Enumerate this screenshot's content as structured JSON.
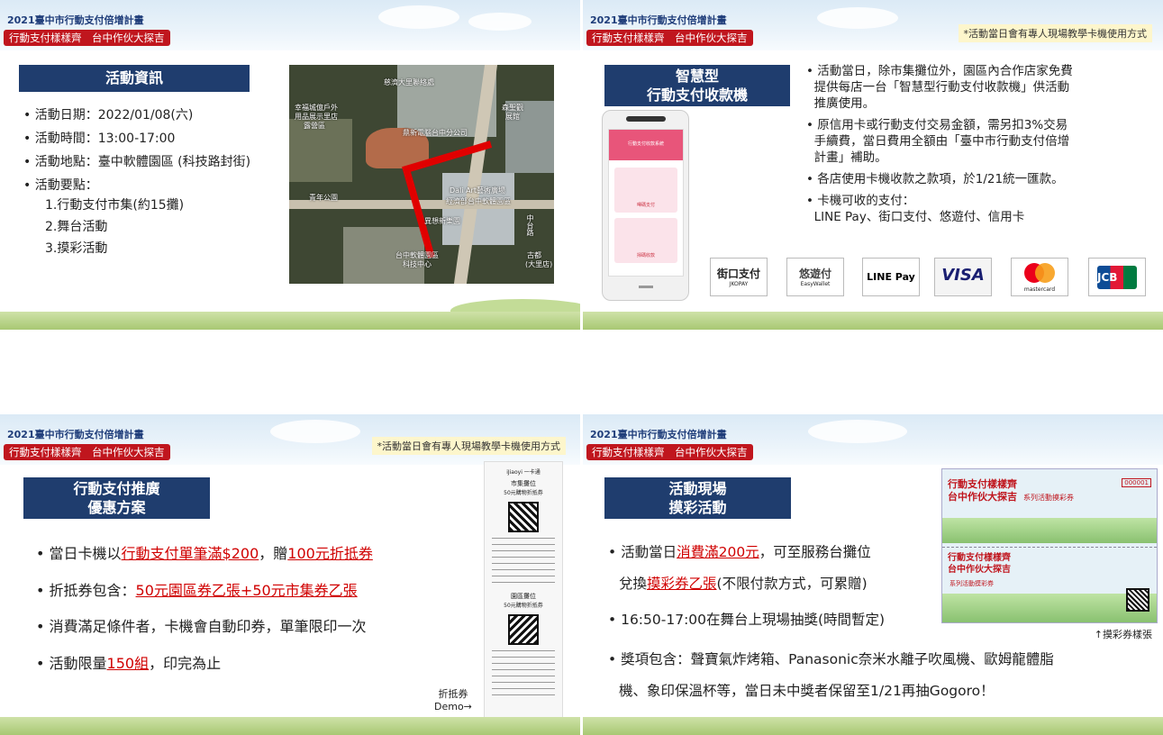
{
  "header": {
    "title": "2021臺中市行動支付倍增計畫",
    "badge": "行動支付樣樣齊　台中作伙大探吉",
    "note": "*活動當日會有專人現場教學卡機使用方式"
  },
  "slide1": {
    "heading": "活動資訊",
    "items": [
      "活動日期：2022/01/08(六)",
      "活動時間：13:00-17:00",
      "活動地點：臺中軟體園區 (科技路封街)",
      "活動要點："
    ],
    "subitems": [
      "1.行動支付市集(約15攤)",
      "2.舞台活動",
      "3.摸彩活動"
    ],
    "map_labels": [
      "慈濟大里聯絡處",
      "幸福城億戶外",
      "用品展示里店",
      "露營區",
      "鼎新電腦台中分公司",
      "森聖觀",
      "展館",
      "青年公園",
      "Dali Art藝術廣場",
      "經濟部台中軟體園區",
      "異想新樂園",
      "台中軟體園區",
      "科技中心",
      "古都",
      "(大里店)",
      "中台路"
    ]
  },
  "slide2": {
    "heading_line1": "智慧型",
    "heading_line2": "行動支付收款機",
    "bullets": [
      [
        "活動當日，除市集攤位外，園區內合作店家免費",
        "提供每店一台「智慧型行動支付收款機」供活動",
        "推廣使用。"
      ],
      [
        "原信用卡或行動支付交易金額，需另扣3%交易",
        "手續費，當日費用全額由「臺中市行動支付倍增",
        "計畫」補助。"
      ],
      [
        "各店使用卡機收款之款項，於1/21統一匯款。"
      ],
      [
        "卡機可收的支付：",
        "LINE Pay、街口支付、悠遊付、信用卡"
      ]
    ],
    "phone_screen": "行動支付收款系統",
    "phone_btn1": "嗶碼支付",
    "phone_btn2": "掃碼收款",
    "logos": [
      "街口支付",
      "JKOPAY",
      "悠遊付",
      "EasyWallet",
      "LINE Pay",
      "VISA",
      "mastercard",
      "JCB"
    ]
  },
  "slide3": {
    "heading_line1": "行動支付推廣",
    "heading_line2": "優惠方案",
    "b1_pre": "當日卡機以",
    "b1_red1": "行動支付單筆滿$200",
    "b1_mid": "，贈",
    "b1_red2": "100元折抵券",
    "b2_pre": "折抵券包含：",
    "b2_red": "50元園區券乙張+50元市集券乙張",
    "b3": "消費滿足條件者，卡機會自動印券，單筆限印一次",
    "b4_pre": "活動限量",
    "b4_red": "150組",
    "b4_post": "，印完為止",
    "receipt_brand": "iJiaoyi 一卡通",
    "receipt_t1": "市集攤位",
    "receipt_t2": "50元購物折抵券",
    "receipt_t3": "園區攤位",
    "receipt_t4": "50元購物折抵券",
    "demo_line1": "折抵券",
    "demo_line2": "Demo→"
  },
  "slide4": {
    "heading_line1": "活動現場",
    "heading_line2": "摸彩活動",
    "b1_pre": "活動當日",
    "b1_red": "消費滿200元",
    "b1_post": "，可至服務台攤位",
    "b1_l2_pre": "兌換",
    "b1_l2_red": "摸彩券乙張",
    "b1_l2_post": "(不限付款方式，可累贈)",
    "b2": "16:50-17:00在舞台上現場抽獎(時間暫定)",
    "b3_l1": "獎項包含：聲寶氣炸烤箱、Panasonic奈米水離子吹風機、歐姆龍體脂",
    "b3_l2": "機、象印保溫杯等，當日未中獎者保留至1/21再抽Gogoro！",
    "ticket_title1": "行動支付樣樣齊",
    "ticket_title2": "台中作伙大探吉",
    "ticket_sub": "系列活動摸彩券",
    "ticket_no": "000001",
    "caption": "↑摸彩券樣張"
  },
  "colors": {
    "red": "#c0161e",
    "navy": "#1f3d6e",
    "highlight": "#d00000"
  }
}
